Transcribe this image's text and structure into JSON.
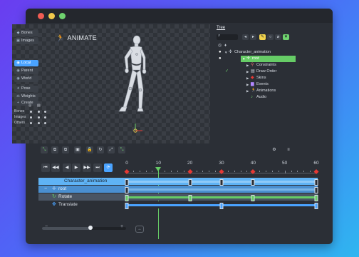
{
  "window": {
    "buttons": [
      "close",
      "minimize",
      "zoom"
    ]
  },
  "viewport": {
    "mode_title": "ANIMATE",
    "tools": [
      {
        "label": "Bones",
        "icon": "bone-icon",
        "active": false
      },
      {
        "label": "Images",
        "icon": "image-icon",
        "active": false
      },
      {
        "label": "Local",
        "icon": "local-icon",
        "active": true
      },
      {
        "label": "Parent",
        "icon": "parent-icon",
        "active": false
      },
      {
        "label": "World",
        "icon": "world-icon",
        "active": false
      },
      {
        "label": "Pose",
        "icon": "pose-icon",
        "active": false
      },
      {
        "label": "Weights",
        "icon": "weights-icon",
        "active": false
      },
      {
        "label": "Create",
        "icon": "create-icon",
        "active": false
      }
    ],
    "visibility_rows": [
      {
        "label": "Bones"
      },
      {
        "label": "Images"
      },
      {
        "label": "Others"
      }
    ]
  },
  "tree": {
    "tab_label": "Tree",
    "items": [
      {
        "label": "Character_animation",
        "icon": "character-icon",
        "depth": 0,
        "selected": false
      },
      {
        "label": "root",
        "icon": "bone-icon",
        "depth": 1,
        "selected": true
      },
      {
        "label": "Constraints",
        "icon": "constraints-icon",
        "depth": 2,
        "selected": false
      },
      {
        "label": "Draw Order",
        "icon": "draw-order-icon",
        "depth": 2,
        "selected": false
      },
      {
        "label": "Skins",
        "icon": "skins-icon",
        "depth": 2,
        "selected": false
      },
      {
        "label": "Events",
        "icon": "events-icon",
        "depth": 2,
        "selected": false
      },
      {
        "label": "Animations",
        "icon": "animations-icon",
        "depth": 2,
        "selected": false
      },
      {
        "label": "Audio",
        "icon": "audio-icon",
        "depth": 2,
        "selected": false
      }
    ]
  },
  "timeline": {
    "ruler_labels": [
      "0",
      "10",
      "20",
      "30",
      "40",
      "50",
      "60"
    ],
    "current_frame": 10,
    "max_frame": 60,
    "rows": [
      {
        "label": "Character_animation",
        "icon": "",
        "keys": [
          0,
          20,
          30,
          40,
          60
        ]
      },
      {
        "label": "root",
        "icon": "bone-icon",
        "keys": [
          0,
          60
        ]
      },
      {
        "label": "Rotate",
        "icon": "rotate-icon",
        "keys": [
          0,
          20,
          40,
          60
        ]
      },
      {
        "label": "Translate",
        "icon": "translate-icon",
        "keys": [
          0,
          30,
          60
        ]
      }
    ],
    "zoom_level": 0.58,
    "scroll_label": "↔"
  }
}
